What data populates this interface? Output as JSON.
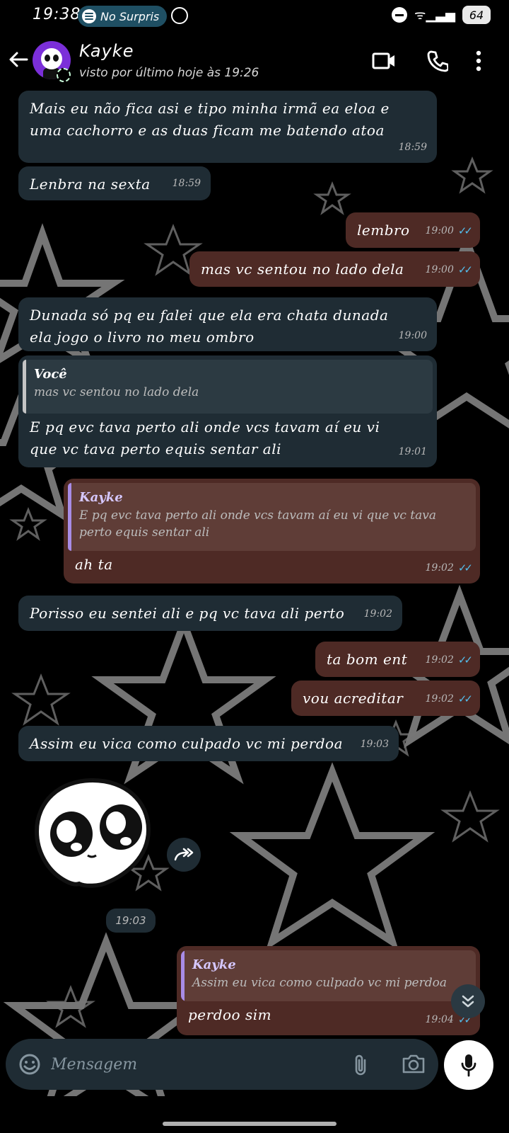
{
  "status_bar": {
    "time": "19:38",
    "spotify_text": "No Surpris",
    "battery": "64"
  },
  "header": {
    "contact_name": "Kayke",
    "last_seen": "visto por último hoje às 19:26"
  },
  "messages": [
    {
      "dir": "in",
      "text": "Mais eu não  fica asi e tipo minha irmã ea eloa e uma cachorro e as duas ficam me batendo atoa",
      "time": "18:59"
    },
    {
      "dir": "in",
      "text": "Lenbra na sexta",
      "time": "18:59"
    },
    {
      "dir": "out",
      "text": "lembro",
      "time": "19:00"
    },
    {
      "dir": "out",
      "text": "mas vc sentou no lado dela",
      "time": "19:00"
    },
    {
      "dir": "in",
      "text": "Dunada só pq eu falei que ela era chata dunada ela jogo o livro no meu ombro",
      "time": "19:00"
    },
    {
      "dir": "in",
      "reply_name": "Você",
      "reply_text": "mas vc sentou no lado dela",
      "text": "E pq evc tava perto ali onde vcs tavam aí eu vi que vc tava perto equis sentar ali",
      "time": "19:01"
    },
    {
      "dir": "out",
      "reply_name": "Kayke",
      "reply_text": "E pq evc tava perto ali onde vcs tavam aí eu vi que vc tava perto equis sentar ali",
      "text": "ah ta",
      "time": "19:02"
    },
    {
      "dir": "in",
      "text": "Porisso eu sentei ali e pq vc tava ali perto",
      "time": "19:02"
    },
    {
      "dir": "out",
      "text": "ta bom ent",
      "time": "19:02"
    },
    {
      "dir": "out",
      "text": "vou acreditar",
      "time": "19:02"
    },
    {
      "dir": "in",
      "text": "Assim eu vica como culpado vc mi perdoa",
      "time": "19:03"
    },
    {
      "dir": "in",
      "sticker": "crying-ghost-sticker",
      "time": "19:03"
    },
    {
      "dir": "out",
      "reply_name": "Kayke",
      "reply_text": "Assim eu vica como culpado vc mi perdoa",
      "text": "perdoo sim",
      "time": "19:04"
    }
  ],
  "input": {
    "placeholder": "Mensagem"
  },
  "icons": {
    "back": "arrow-left-icon",
    "video": "video-call-icon",
    "phone": "phone-icon",
    "menu": "more-vert-icon",
    "emoji": "emoji-icon",
    "attach": "paperclip-icon",
    "camera": "camera-icon",
    "mic": "mic-icon",
    "forward": "forward-icon",
    "scroll_down": "double-chevron-down-icon"
  },
  "colors": {
    "incoming_bubble": "#1f2c34",
    "outgoing_bubble": "#4e2a25",
    "read_ticks": "#53bdeb"
  }
}
